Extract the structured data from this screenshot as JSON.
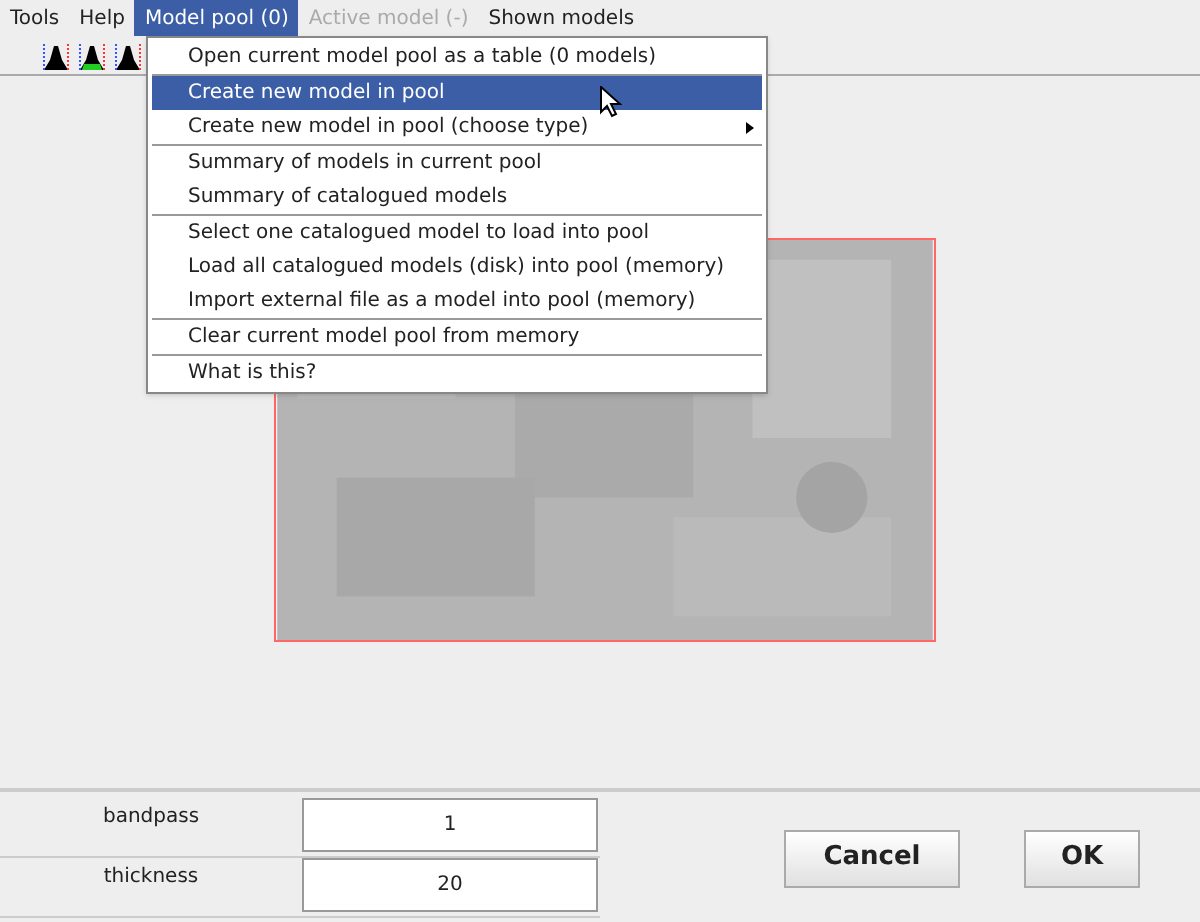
{
  "menu_bar": [
    {
      "label": "Tools",
      "selected": false,
      "disabled": false
    },
    {
      "label": "Help",
      "selected": false,
      "disabled": false
    },
    {
      "label": "Model pool (0)",
      "selected": true,
      "disabled": false
    },
    {
      "label": "Active model (-)",
      "selected": false,
      "disabled": true
    },
    {
      "label": "Shown models",
      "selected": false,
      "disabled": false
    }
  ],
  "dropdown": {
    "groups": [
      [
        {
          "label": "Open current model pool as a table (0 models)",
          "selected": false,
          "submenu": false
        }
      ],
      [
        {
          "label": "Create new model in pool",
          "selected": true,
          "submenu": false
        },
        {
          "label": "Create new model in pool (choose type)",
          "selected": false,
          "submenu": true
        }
      ],
      [
        {
          "label": "Summary of models in current pool",
          "selected": false,
          "submenu": false
        },
        {
          "label": "Summary of catalogued models",
          "selected": false,
          "submenu": false
        }
      ],
      [
        {
          "label": "Select one catalogued model to load into pool",
          "selected": false,
          "submenu": false
        },
        {
          "label": "Load all catalogued models (disk) into pool (memory)",
          "selected": false,
          "submenu": false
        },
        {
          "label": "Import external file as a model into pool (memory)",
          "selected": false,
          "submenu": false
        }
      ],
      [
        {
          "label": "Clear current model pool from memory",
          "selected": false,
          "submenu": false
        }
      ],
      [
        {
          "label": "What is this?",
          "selected": false,
          "submenu": false
        }
      ]
    ]
  },
  "parameters": [
    {
      "label": "bandpass",
      "value": "1"
    },
    {
      "label": "thickness",
      "value": "20"
    }
  ],
  "buttons": [
    "Cancel",
    "OK"
  ]
}
